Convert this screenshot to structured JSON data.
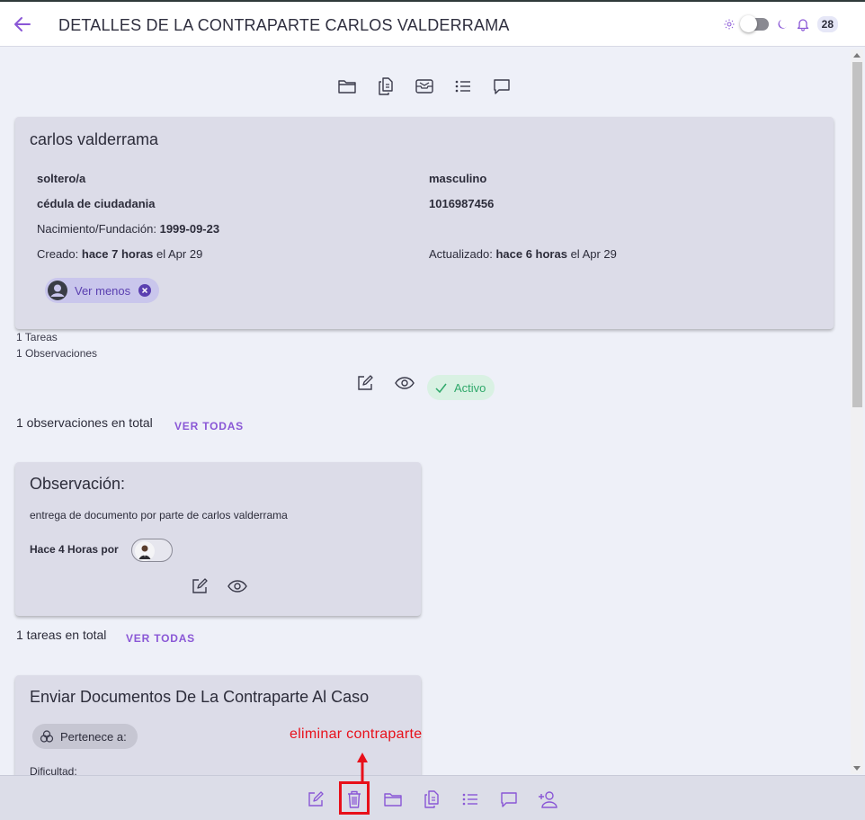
{
  "header": {
    "title": "DETALLES DE LA CONTRAPARTE CARLOS VALDERRAMA",
    "notification_count": "28"
  },
  "person": {
    "name": "carlos valderrama",
    "marital_status": "soltero/a",
    "gender": "masculino",
    "document_type": "cédula de ciudadania",
    "document_number": "1016987456",
    "birth_label": "Nacimiento/Fundación:",
    "birth_date": "1999-09-23",
    "created_label": "Creado:",
    "created_relative": "hace 7 horas",
    "created_suffix": "el Apr 29",
    "updated_label": "Actualizado:",
    "updated_relative": "hace 6 horas",
    "updated_suffix": "el Apr 29",
    "toggle_label": "Ver menos"
  },
  "summary": {
    "tasks_count": "1 Tareas",
    "observations_count": "1 Observaciones",
    "status": "Activo"
  },
  "observations": {
    "total_text": "1 observaciones en total",
    "see_all": "VER TODAS",
    "card": {
      "title": "Observación:",
      "body": "entrega de documento por parte de carlos valderrama",
      "meta": "Hace 4 Horas por"
    }
  },
  "tasks": {
    "total_text": "1 tareas en total",
    "see_all": "VER TODAS",
    "card": {
      "title": "Enviar Documentos De La Contraparte Al Caso",
      "belongs_label": "Pertenece a:",
      "difficulty_label": "Dificultad:"
    }
  },
  "annotation": {
    "text": "eliminar contraparte"
  },
  "colors": {
    "accent": "#8a57d6",
    "annotation": "#e8101a",
    "active_green": "#2fa86a"
  }
}
